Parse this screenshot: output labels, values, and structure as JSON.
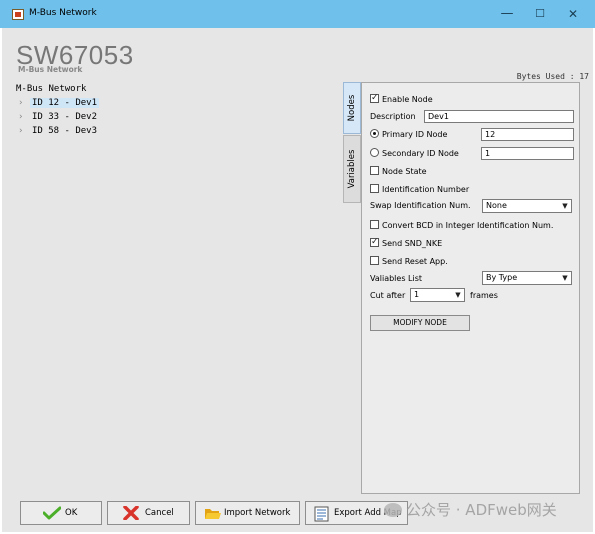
{
  "window": {
    "title": "M-Bus Network",
    "controls": {
      "minimize": "—",
      "maximize": "☐",
      "close": "✕"
    }
  },
  "header": {
    "app_name": "SW67053",
    "app_subtitle": "M-Bus Network",
    "bytes_used": "Bytes Used : 17"
  },
  "tree": {
    "root": "M-Bus Network",
    "items": [
      {
        "label": "ID 12 - Dev1",
        "selected": true
      },
      {
        "label": "ID 33 - Dev2",
        "selected": false
      },
      {
        "label": "ID 58 - Dev3",
        "selected": false
      }
    ]
  },
  "tabs": [
    {
      "label": "Nodes",
      "active": true
    },
    {
      "label": "Variables",
      "active": false
    }
  ],
  "node_form": {
    "enable_node": {
      "label": "Enable Node",
      "checked": true
    },
    "description": {
      "label": "Description",
      "value": "Dev1"
    },
    "primary_id": {
      "label": "Primary ID Node",
      "value": "12",
      "selected": true
    },
    "secondary_id": {
      "label": "Secondary ID Node",
      "value": "1",
      "selected": false
    },
    "node_state": {
      "label": "Node State",
      "checked": false
    },
    "identification_number": {
      "label": "Identification Number",
      "checked": false
    },
    "swap_identification": {
      "label": "Swap Identification Num.",
      "value": "None"
    },
    "convert_bcd": {
      "label": "Convert BCD in Integer Identification Num.",
      "checked": false
    },
    "send_snd_nke": {
      "label": "Send SND_NKE",
      "checked": true
    },
    "send_reset": {
      "label": "Send Reset App.",
      "checked": false
    },
    "variables_list": {
      "label": "Valiables List",
      "value": "By Type"
    },
    "cut_after": {
      "label": "Cut after",
      "value": "1",
      "suffix": "frames"
    },
    "modify_button": "MODIFY NODE"
  },
  "bottom_buttons": {
    "ok": "OK",
    "cancel": "Cancel",
    "import": "Import Network",
    "export": "Export Add Map"
  },
  "watermark": "公众号 · ADFweb网关",
  "colors": {
    "titlebar": "#6fc1ec",
    "client": "#e6e6e6",
    "panel": "#ececec",
    "selection": "#cfe6f7",
    "ok_check": "#4caf2a",
    "cancel_x": "#d9342b",
    "folder": "#f0b81e"
  }
}
